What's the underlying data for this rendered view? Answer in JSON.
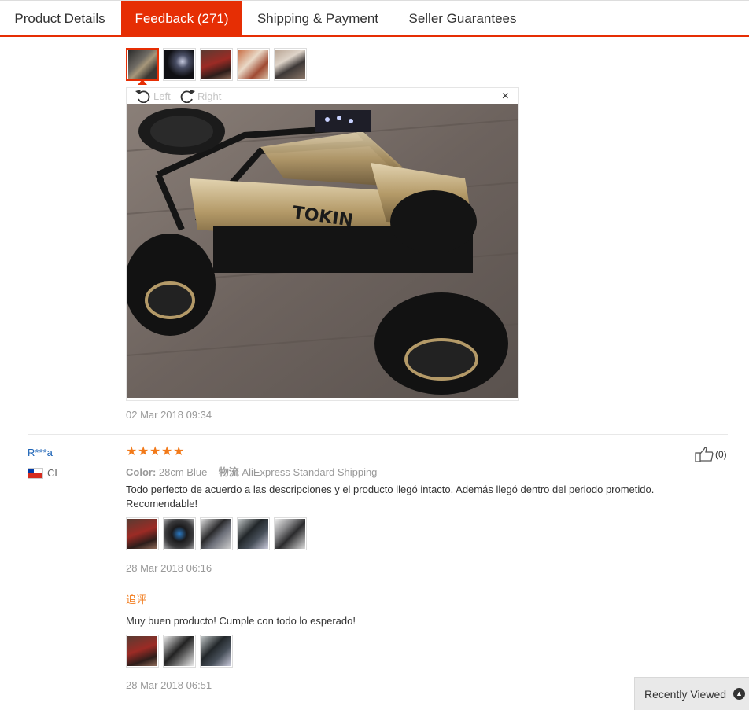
{
  "tabs": [
    {
      "label": "Product Details",
      "active": false
    },
    {
      "label": "Feedback (271)",
      "active": true
    },
    {
      "label": "Shipping & Payment",
      "active": false
    },
    {
      "label": "Seller Guarantees",
      "active": false
    }
  ],
  "viewer": {
    "rotate_left": "Left",
    "rotate_right": "Right",
    "close": "×"
  },
  "first_review": {
    "date": "02 Mar 2018 09:34"
  },
  "review": {
    "user": "R***a",
    "country": "CL",
    "rating": 5,
    "stars": [
      "★",
      "★",
      "★",
      "★",
      "★"
    ],
    "color_label": "Color:",
    "color_value": "28cm Blue",
    "shipping_label": "物流",
    "shipping_value": "AliExpress Standard Shipping",
    "text": "Todo perfecto de acuerdo a las descripciones y el producto llegó intacto. Además llegó dentro del periodo prometido. Recomendable!",
    "date": "28 Mar 2018 06:16",
    "helpful_count": "(0)",
    "followup": {
      "label": "追评",
      "text": "Muy buen producto! Cumple con todo lo esperado!",
      "date": "28 Mar 2018 06:51"
    }
  },
  "recently_viewed": {
    "label": "Recently Viewed",
    "icon": "chevron-up-icon"
  },
  "colors": {
    "accent": "#e62e04",
    "star": "#f27a1a",
    "link": "#1c63b6"
  }
}
